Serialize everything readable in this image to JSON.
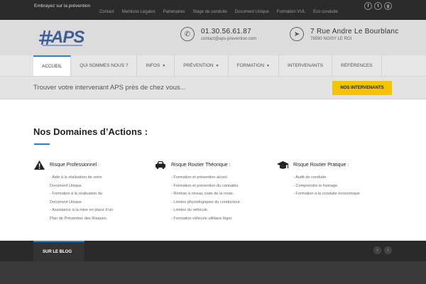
{
  "topbar": {
    "tagline": "Embrayez sur la prévention",
    "links": [
      "Contact",
      "Mentions Légales",
      "Partenaires",
      "Stage de conduite",
      "Document Unique",
      "Formation VUL",
      "Eco conduite"
    ],
    "social": [
      "facebook-icon",
      "twitter-icon",
      "google-plus-icon"
    ]
  },
  "header": {
    "logo_text": "APS",
    "phone": "01.30.56.61.87",
    "email": "contact@aps-prevention.com",
    "address_line1": "7 Rue Andre Le Bourblanc",
    "address_line2": "78590 NOISY LE ROI"
  },
  "nav": {
    "items": [
      {
        "label": "Accueil",
        "active": true
      },
      {
        "label": "Qui sommes nous ?"
      },
      {
        "label": "Infos",
        "dropdown": true
      },
      {
        "label": "Prévention",
        "dropdown": true
      },
      {
        "label": "Formation",
        "dropdown": true
      },
      {
        "label": "Intervenants"
      },
      {
        "label": "Références"
      }
    ]
  },
  "band": {
    "text": "Trouver votre intervenant APS près de chez vous...",
    "button": "Nos intervenants"
  },
  "main": {
    "title": "Nos Domaines d’Actions :",
    "columns": [
      {
        "icon": "warning-icon",
        "heading": "Risque Professionnel :",
        "lines": [
          "- Aide à la réalisation de votre",
          "Document Unique.",
          "- Formation à la réalisation du",
          "Document Unique.",
          "- Assistance à la mise en place d’un",
          "Plan de Prévention des Risques."
        ]
      },
      {
        "icon": "car-icon",
        "heading": "Risque Routier Théorique :",
        "lines": [
          "- Formation et prévention alcool.",
          "- Formation et prévention du cannabis.",
          "- Remise à niveau code de la route.",
          "- Limites physiologiques du conducteur.",
          "- Limites du véhicule.",
          "- Formation véhicule utilitaire léger"
        ]
      },
      {
        "icon": "graduation-cap-icon",
        "heading": "Risque Routier Pratique :",
        "lines": [
          "- Audit de conduite",
          "- Comprendre le freinage.",
          "- Formation à la conduite économique"
        ]
      }
    ]
  },
  "blog": {
    "tab": "Sur le blog"
  },
  "colors": {
    "accent": "#2c7fc8",
    "button": "#f5c400",
    "logo": "#3f5f96"
  }
}
